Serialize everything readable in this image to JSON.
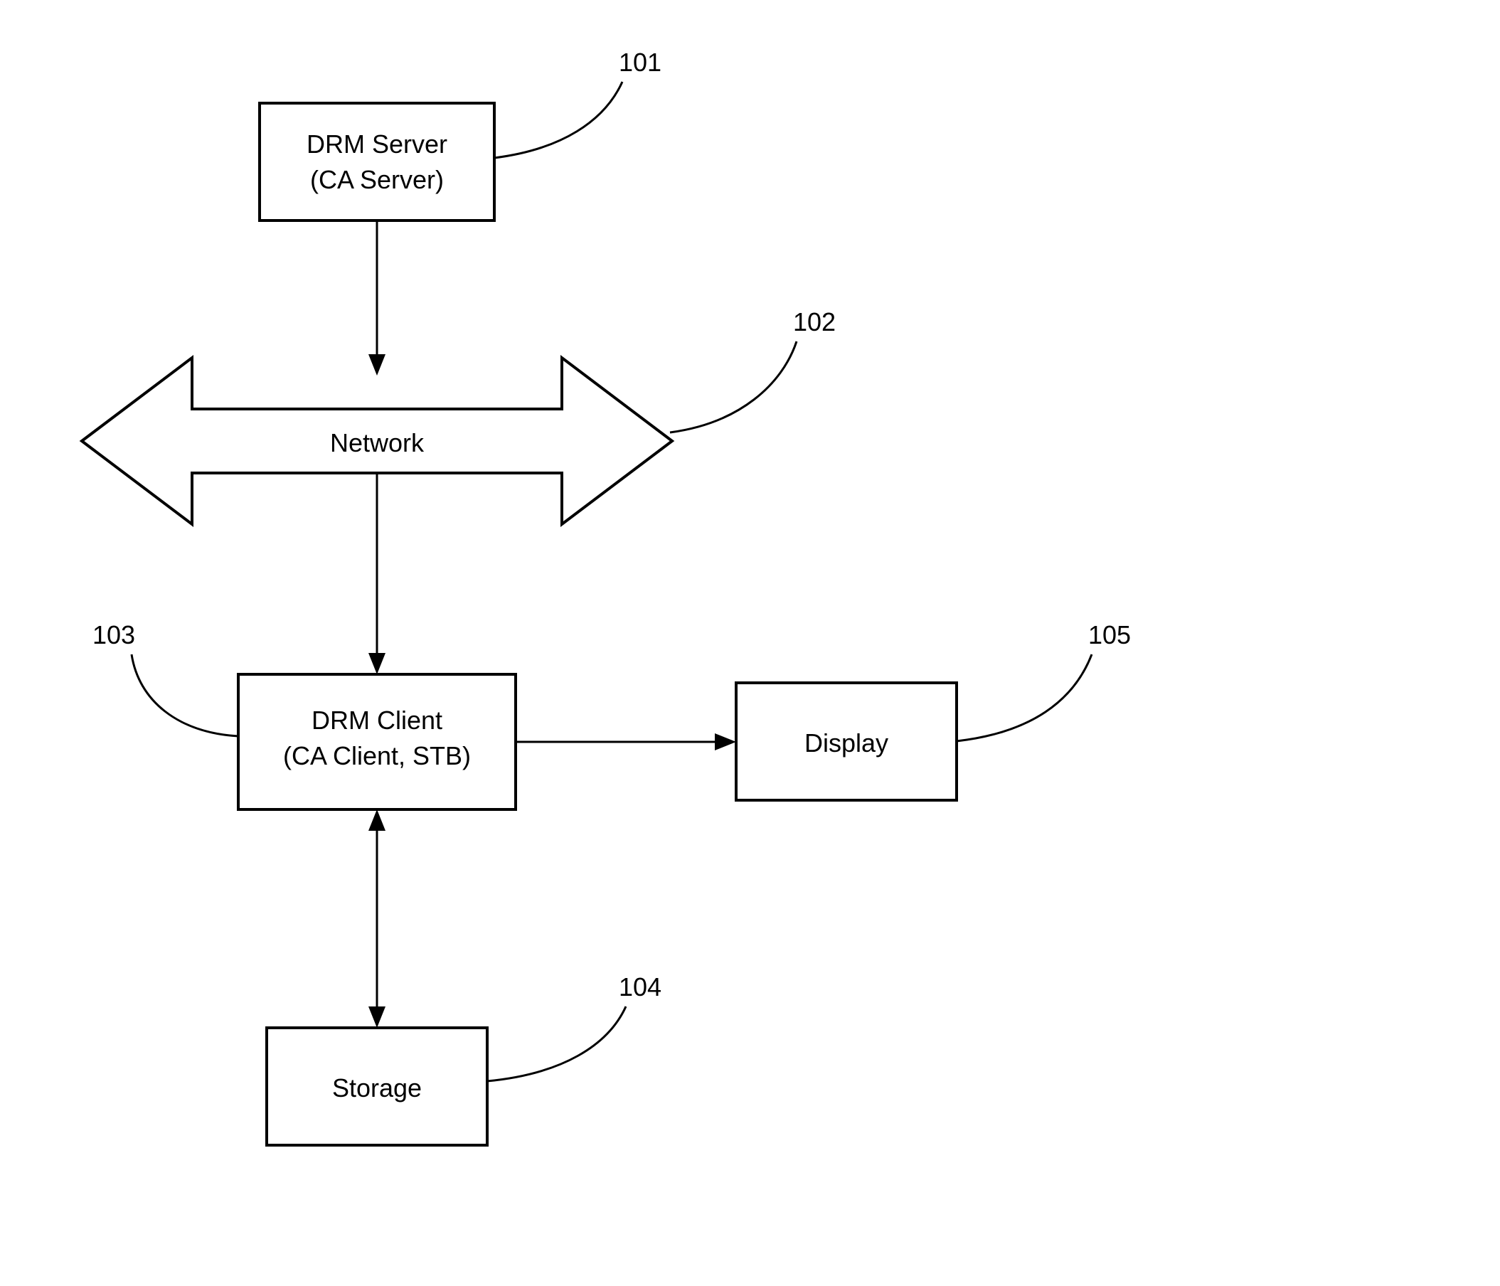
{
  "blocks": {
    "drm_server": {
      "line1": "DRM Server",
      "line2": "(CA Server)"
    },
    "network": {
      "label": "Network"
    },
    "drm_client": {
      "line1": "DRM Client",
      "line2": "(CA Client, STB)"
    },
    "storage": {
      "label": "Storage"
    },
    "display": {
      "label": "Display"
    }
  },
  "refs": {
    "r101": "101",
    "r102": "102",
    "r103": "103",
    "r104": "104",
    "r105": "105"
  }
}
